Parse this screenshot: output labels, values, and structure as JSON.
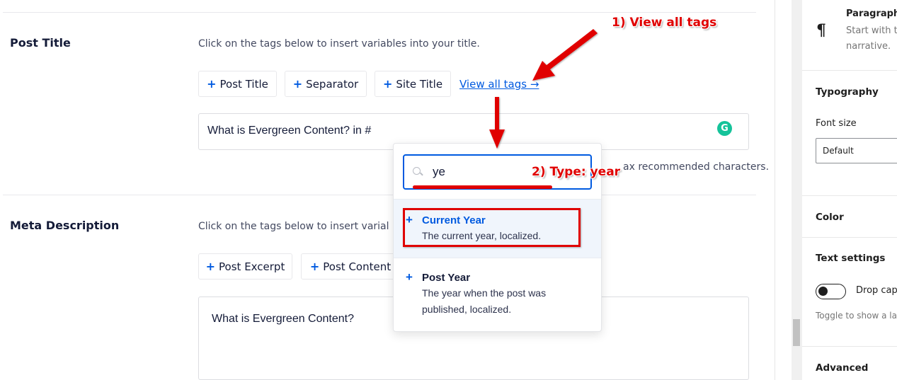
{
  "post_title_section": {
    "label": "Post Title",
    "hint": "Click on the tags below to insert variables into your title.",
    "tags": [
      {
        "plus": "+",
        "label": "Post Title"
      },
      {
        "plus": "+",
        "label": "Separator"
      },
      {
        "plus": "+",
        "label": "Site Title"
      }
    ],
    "view_all_link": "View all tags →",
    "input_value": "What is Evergreen Content? in #",
    "char_hint_partial": "ax recommended characters.",
    "grammarly_icon": "G"
  },
  "meta_description_section": {
    "label": "Meta Description",
    "hint_partial": "Click on the tags below to insert varial",
    "tags": [
      {
        "plus": "+",
        "label": "Post Excerpt"
      },
      {
        "plus": "+",
        "label": "Post Content"
      }
    ],
    "input_value": "What is Evergreen Content?"
  },
  "tag_popup": {
    "search_value": "ye",
    "search_icon": "search-icon",
    "items": [
      {
        "plus": "+",
        "name": "Current Year",
        "description": "The current year, localized.",
        "highlighted": true
      },
      {
        "plus": "+",
        "name": "Post Year",
        "description_line1": "The year when the post was",
        "description_line2": "published, localized.",
        "highlighted": false
      }
    ]
  },
  "annotations": {
    "step1": "1) View all tags",
    "step2": "2) Type: year",
    "color": "#e00000"
  },
  "sidebar": {
    "block": {
      "icon": "¶",
      "title": "Paragraph",
      "desc_line1": "Start with t",
      "desc_line2": "narrative."
    },
    "typography": {
      "title": "Typography",
      "font_size_label": "Font size",
      "font_size_value": "Default"
    },
    "color": {
      "title": "Color"
    },
    "text_settings": {
      "title": "Text settings",
      "drop_cap_label": "Drop cap",
      "drop_cap_on": false,
      "help_partial": "Toggle to show a la"
    },
    "advanced": {
      "title": "Advanced"
    }
  },
  "colors": {
    "accent": "#005ae0",
    "grammarly": "#15c39a",
    "highlight_bg": "#f0f5fc"
  }
}
